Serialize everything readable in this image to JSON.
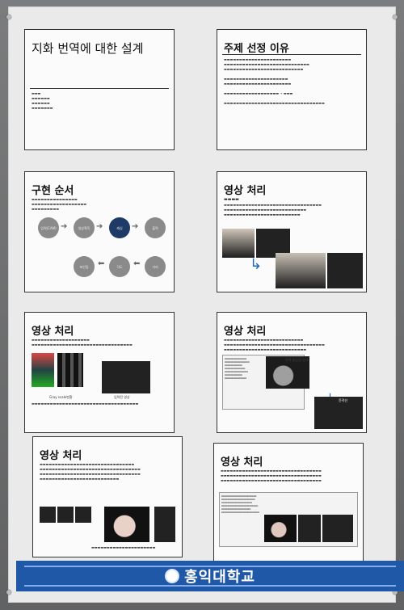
{
  "banner": {
    "text": "홍익대학교"
  },
  "slides": [
    {
      "title": "지화 번역에 대한 설계"
    },
    {
      "title": "주제 선정 이유"
    },
    {
      "title": "구현 순서",
      "steps": [
        "입력(CAM)",
        "영상획득",
        "캐싱",
        "출력",
        "포인팅",
        "각도",
        "거리"
      ]
    },
    {
      "title": "영상 처리"
    },
    {
      "title": "영상 처리",
      "labels": [
        "Gray scale변환",
        "입력된 영상"
      ]
    },
    {
      "title": "영상 처리",
      "labels": [
        "무게 중심점 검색",
        "윤곽선"
      ]
    },
    {
      "title": "영상 처리"
    },
    {
      "title": "영상 처리"
    }
  ]
}
